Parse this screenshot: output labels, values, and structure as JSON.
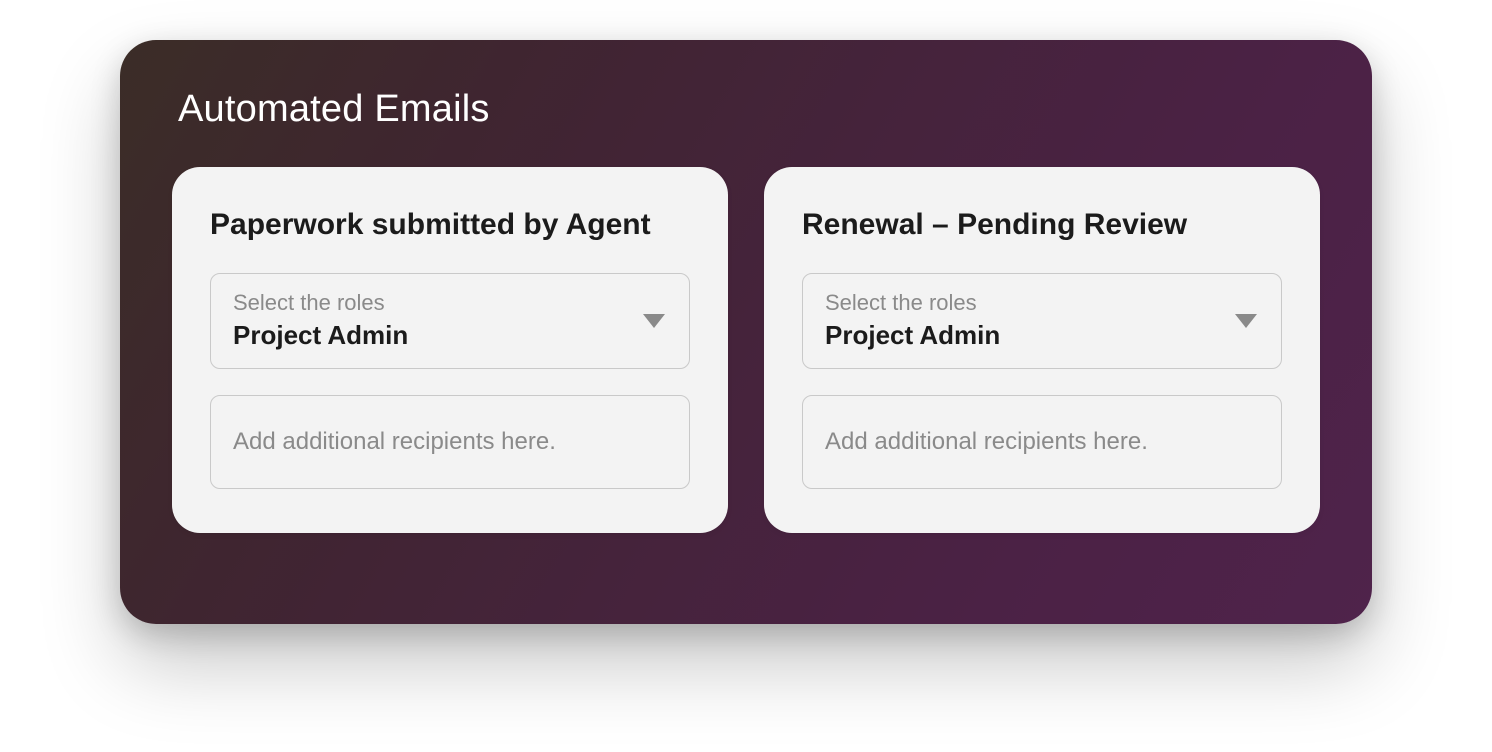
{
  "panel": {
    "title": "Automated Emails"
  },
  "cards": [
    {
      "title": "Paperwork submitted by Agent",
      "select": {
        "label": "Select the roles",
        "value": "Project Admin"
      },
      "recipients_placeholder": "Add additional recipients here."
    },
    {
      "title": "Renewal – Pending Review",
      "select": {
        "label": "Select the roles",
        "value": "Project Admin"
      },
      "recipients_placeholder": "Add additional recipients here."
    }
  ]
}
